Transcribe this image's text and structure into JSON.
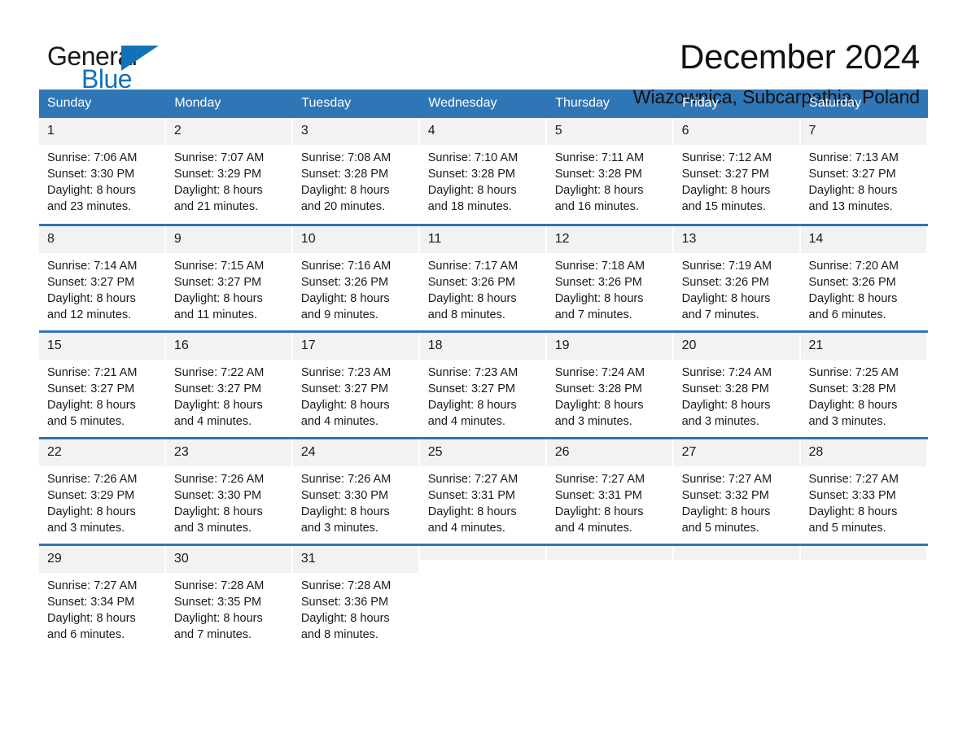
{
  "brand": {
    "name_part1": "General",
    "name_part2": "Blue",
    "colors": {
      "accent_blue": "#1272b8",
      "header_blue": "#2f76b6",
      "daynum_gray": "#f2f2f2"
    }
  },
  "header": {
    "title": "December 2024",
    "subtitle": "Wiazownica, Subcarpathia, Poland"
  },
  "calendar": {
    "weekday_headers": [
      "Sunday",
      "Monday",
      "Tuesday",
      "Wednesday",
      "Thursday",
      "Friday",
      "Saturday"
    ],
    "weeks": [
      [
        {
          "day": "1",
          "sunrise": "Sunrise: 7:06 AM",
          "sunset": "Sunset: 3:30 PM",
          "daylight_line1": "Daylight: 8 hours",
          "daylight_line2": "and 23 minutes."
        },
        {
          "day": "2",
          "sunrise": "Sunrise: 7:07 AM",
          "sunset": "Sunset: 3:29 PM",
          "daylight_line1": "Daylight: 8 hours",
          "daylight_line2": "and 21 minutes."
        },
        {
          "day": "3",
          "sunrise": "Sunrise: 7:08 AM",
          "sunset": "Sunset: 3:28 PM",
          "daylight_line1": "Daylight: 8 hours",
          "daylight_line2": "and 20 minutes."
        },
        {
          "day": "4",
          "sunrise": "Sunrise: 7:10 AM",
          "sunset": "Sunset: 3:28 PM",
          "daylight_line1": "Daylight: 8 hours",
          "daylight_line2": "and 18 minutes."
        },
        {
          "day": "5",
          "sunrise": "Sunrise: 7:11 AM",
          "sunset": "Sunset: 3:28 PM",
          "daylight_line1": "Daylight: 8 hours",
          "daylight_line2": "and 16 minutes."
        },
        {
          "day": "6",
          "sunrise": "Sunrise: 7:12 AM",
          "sunset": "Sunset: 3:27 PM",
          "daylight_line1": "Daylight: 8 hours",
          "daylight_line2": "and 15 minutes."
        },
        {
          "day": "7",
          "sunrise": "Sunrise: 7:13 AM",
          "sunset": "Sunset: 3:27 PM",
          "daylight_line1": "Daylight: 8 hours",
          "daylight_line2": "and 13 minutes."
        }
      ],
      [
        {
          "day": "8",
          "sunrise": "Sunrise: 7:14 AM",
          "sunset": "Sunset: 3:27 PM",
          "daylight_line1": "Daylight: 8 hours",
          "daylight_line2": "and 12 minutes."
        },
        {
          "day": "9",
          "sunrise": "Sunrise: 7:15 AM",
          "sunset": "Sunset: 3:27 PM",
          "daylight_line1": "Daylight: 8 hours",
          "daylight_line2": "and 11 minutes."
        },
        {
          "day": "10",
          "sunrise": "Sunrise: 7:16 AM",
          "sunset": "Sunset: 3:26 PM",
          "daylight_line1": "Daylight: 8 hours",
          "daylight_line2": "and 9 minutes."
        },
        {
          "day": "11",
          "sunrise": "Sunrise: 7:17 AM",
          "sunset": "Sunset: 3:26 PM",
          "daylight_line1": "Daylight: 8 hours",
          "daylight_line2": "and 8 minutes."
        },
        {
          "day": "12",
          "sunrise": "Sunrise: 7:18 AM",
          "sunset": "Sunset: 3:26 PM",
          "daylight_line1": "Daylight: 8 hours",
          "daylight_line2": "and 7 minutes."
        },
        {
          "day": "13",
          "sunrise": "Sunrise: 7:19 AM",
          "sunset": "Sunset: 3:26 PM",
          "daylight_line1": "Daylight: 8 hours",
          "daylight_line2": "and 7 minutes."
        },
        {
          "day": "14",
          "sunrise": "Sunrise: 7:20 AM",
          "sunset": "Sunset: 3:26 PM",
          "daylight_line1": "Daylight: 8 hours",
          "daylight_line2": "and 6 minutes."
        }
      ],
      [
        {
          "day": "15",
          "sunrise": "Sunrise: 7:21 AM",
          "sunset": "Sunset: 3:27 PM",
          "daylight_line1": "Daylight: 8 hours",
          "daylight_line2": "and 5 minutes."
        },
        {
          "day": "16",
          "sunrise": "Sunrise: 7:22 AM",
          "sunset": "Sunset: 3:27 PM",
          "daylight_line1": "Daylight: 8 hours",
          "daylight_line2": "and 4 minutes."
        },
        {
          "day": "17",
          "sunrise": "Sunrise: 7:23 AM",
          "sunset": "Sunset: 3:27 PM",
          "daylight_line1": "Daylight: 8 hours",
          "daylight_line2": "and 4 minutes."
        },
        {
          "day": "18",
          "sunrise": "Sunrise: 7:23 AM",
          "sunset": "Sunset: 3:27 PM",
          "daylight_line1": "Daylight: 8 hours",
          "daylight_line2": "and 4 minutes."
        },
        {
          "day": "19",
          "sunrise": "Sunrise: 7:24 AM",
          "sunset": "Sunset: 3:28 PM",
          "daylight_line1": "Daylight: 8 hours",
          "daylight_line2": "and 3 minutes."
        },
        {
          "day": "20",
          "sunrise": "Sunrise: 7:24 AM",
          "sunset": "Sunset: 3:28 PM",
          "daylight_line1": "Daylight: 8 hours",
          "daylight_line2": "and 3 minutes."
        },
        {
          "day": "21",
          "sunrise": "Sunrise: 7:25 AM",
          "sunset": "Sunset: 3:28 PM",
          "daylight_line1": "Daylight: 8 hours",
          "daylight_line2": "and 3 minutes."
        }
      ],
      [
        {
          "day": "22",
          "sunrise": "Sunrise: 7:26 AM",
          "sunset": "Sunset: 3:29 PM",
          "daylight_line1": "Daylight: 8 hours",
          "daylight_line2": "and 3 minutes."
        },
        {
          "day": "23",
          "sunrise": "Sunrise: 7:26 AM",
          "sunset": "Sunset: 3:30 PM",
          "daylight_line1": "Daylight: 8 hours",
          "daylight_line2": "and 3 minutes."
        },
        {
          "day": "24",
          "sunrise": "Sunrise: 7:26 AM",
          "sunset": "Sunset: 3:30 PM",
          "daylight_line1": "Daylight: 8 hours",
          "daylight_line2": "and 3 minutes."
        },
        {
          "day": "25",
          "sunrise": "Sunrise: 7:27 AM",
          "sunset": "Sunset: 3:31 PM",
          "daylight_line1": "Daylight: 8 hours",
          "daylight_line2": "and 4 minutes."
        },
        {
          "day": "26",
          "sunrise": "Sunrise: 7:27 AM",
          "sunset": "Sunset: 3:31 PM",
          "daylight_line1": "Daylight: 8 hours",
          "daylight_line2": "and 4 minutes."
        },
        {
          "day": "27",
          "sunrise": "Sunrise: 7:27 AM",
          "sunset": "Sunset: 3:32 PM",
          "daylight_line1": "Daylight: 8 hours",
          "daylight_line2": "and 5 minutes."
        },
        {
          "day": "28",
          "sunrise": "Sunrise: 7:27 AM",
          "sunset": "Sunset: 3:33 PM",
          "daylight_line1": "Daylight: 8 hours",
          "daylight_line2": "and 5 minutes."
        }
      ],
      [
        {
          "day": "29",
          "sunrise": "Sunrise: 7:27 AM",
          "sunset": "Sunset: 3:34 PM",
          "daylight_line1": "Daylight: 8 hours",
          "daylight_line2": "and 6 minutes."
        },
        {
          "day": "30",
          "sunrise": "Sunrise: 7:28 AM",
          "sunset": "Sunset: 3:35 PM",
          "daylight_line1": "Daylight: 8 hours",
          "daylight_line2": "and 7 minutes."
        },
        {
          "day": "31",
          "sunrise": "Sunrise: 7:28 AM",
          "sunset": "Sunset: 3:36 PM",
          "daylight_line1": "Daylight: 8 hours",
          "daylight_line2": "and 8 minutes."
        },
        {
          "day": "",
          "sunrise": "",
          "sunset": "",
          "daylight_line1": "",
          "daylight_line2": ""
        },
        {
          "day": "",
          "sunrise": "",
          "sunset": "",
          "daylight_line1": "",
          "daylight_line2": ""
        },
        {
          "day": "",
          "sunrise": "",
          "sunset": "",
          "daylight_line1": "",
          "daylight_line2": ""
        },
        {
          "day": "",
          "sunrise": "",
          "sunset": "",
          "daylight_line1": "",
          "daylight_line2": ""
        }
      ]
    ]
  }
}
